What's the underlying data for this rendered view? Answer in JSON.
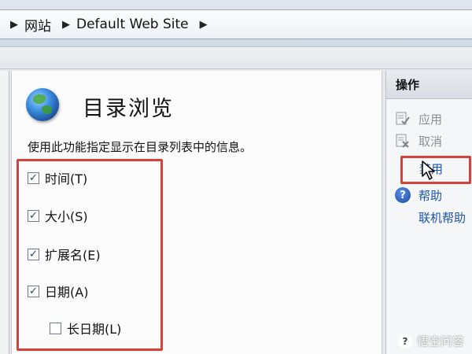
{
  "address_bar": {
    "breadcrumbs": [
      "网站",
      "Default Web Site"
    ]
  },
  "main": {
    "title": "目录浏览",
    "icon": "globe-icon",
    "description": "使用此功能指定显示在目录列表中的信息。",
    "options": [
      {
        "label": "时间(T)",
        "checked": true
      },
      {
        "label": "大小(S)",
        "checked": true
      },
      {
        "label": "扩展名(E)",
        "checked": true
      },
      {
        "label": "日期(A)",
        "checked": true
      },
      {
        "label": "长日期(L)",
        "checked": false
      }
    ]
  },
  "actions": {
    "header": "操作",
    "items": [
      {
        "label": "应用",
        "icon": "apply-icon",
        "enabled": false
      },
      {
        "label": "取消",
        "icon": "cancel-icon",
        "enabled": false
      },
      {
        "label": "禁用",
        "icon": "",
        "enabled": true
      },
      {
        "label": "帮助",
        "icon": "help-icon",
        "enabled": true
      },
      {
        "label": "联机帮助",
        "icon": "",
        "enabled": true
      }
    ]
  },
  "watermark": {
    "text": "悟空问答"
  },
  "colors": {
    "highlight_frame": "#d8413a",
    "link": "#1a55a8",
    "disabled_text": "#8a8f96"
  }
}
